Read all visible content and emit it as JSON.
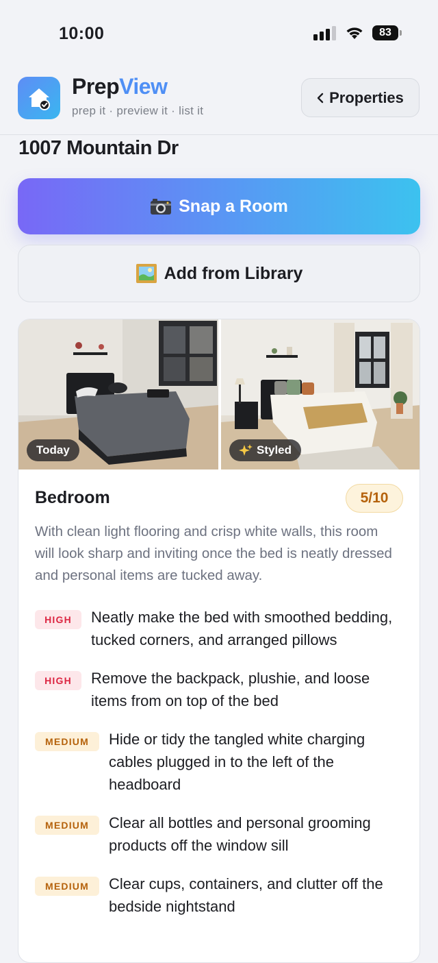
{
  "status_bar": {
    "time": "10:00",
    "battery": "83"
  },
  "header": {
    "brand_part1": "Prep",
    "brand_part2": "View",
    "tagline": "prep it · preview it · list it",
    "properties_label": "Properties"
  },
  "address": "1007 Mountain Dr",
  "actions": {
    "snap_label": "Snap a Room",
    "library_label": "Add from Library"
  },
  "room": {
    "photo_today_label": "Today",
    "photo_styled_label": "Styled",
    "title": "Bedroom",
    "score": "5/10",
    "summary": "With clean light flooring and crisp white walls, this room will look sharp and inviting once the bed is neatly dressed and personal items are tucked away.",
    "tasks": [
      {
        "priority": "HIGH",
        "text": "Neatly make the bed with smoothed bedding, tucked corners, and arranged pillows"
      },
      {
        "priority": "HIGH",
        "text": "Remove the backpack, plushie, and loose items from on top of the bed"
      },
      {
        "priority": "MEDIUM",
        "text": "Hide or tidy the tangled white charging cables plugged in to the left of the headboard"
      },
      {
        "priority": "MEDIUM",
        "text": "Clear all bottles and personal grooming products off the window sill"
      },
      {
        "priority": "MEDIUM",
        "text": "Clear cups, containers, and clutter off the bedside nightstand"
      }
    ]
  },
  "colors": {
    "accent_blue": "#4f8ff5",
    "gradient_start": "#7868f6",
    "gradient_end": "#3cc2ef",
    "high_priority": "#dc2642",
    "medium_priority": "#b5620c"
  }
}
